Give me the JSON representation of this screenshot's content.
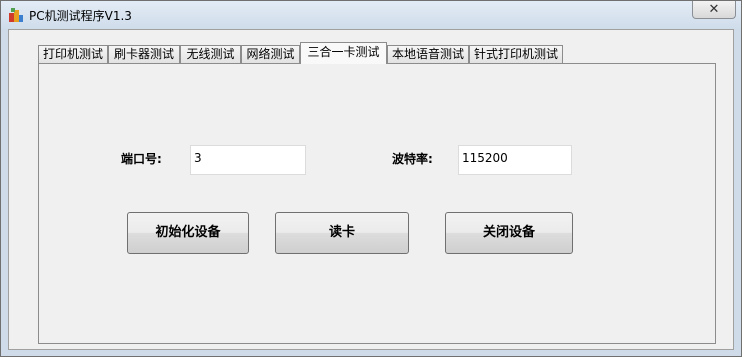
{
  "window": {
    "title": "PC机测试程序V1.3",
    "close_glyph": "✕"
  },
  "tabs": [
    {
      "label": "打印机测试"
    },
    {
      "label": "刷卡器测试"
    },
    {
      "label": "无线测试"
    },
    {
      "label": "网络测试"
    },
    {
      "label": "三合一卡测试",
      "active": true
    },
    {
      "label": "本地语音测试"
    },
    {
      "label": "针式打印机测试"
    }
  ],
  "form": {
    "port_label": "端口号:",
    "port_value": "3",
    "baud_label": "波特率:",
    "baud_value": "115200"
  },
  "buttons": {
    "init_label": "初始化设备",
    "read_label": "读卡",
    "close_label": "关闭设备"
  }
}
